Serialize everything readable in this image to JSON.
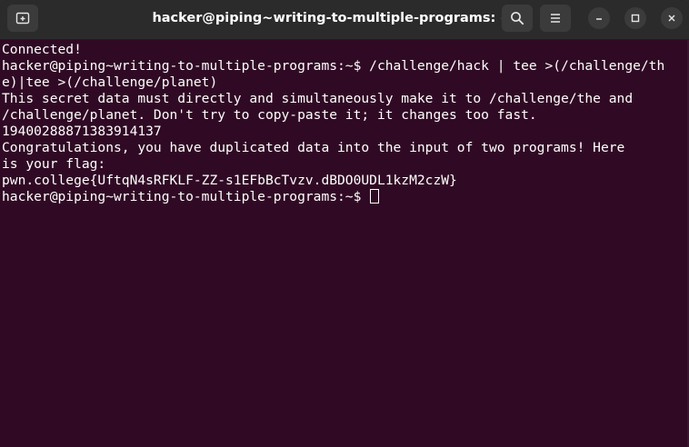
{
  "window": {
    "title": "hacker@piping~writing-to-multiple-programs: ~"
  },
  "titlebar_icons": {
    "new_tab": "new-tab-icon",
    "search": "search-icon",
    "menu": "hamburger-menu-icon",
    "minimize": "minimize-icon",
    "maximize": "maximize-icon",
    "close": "close-icon"
  },
  "terminal": {
    "lines": [
      "Connected!",
      "hacker@piping~writing-to-multiple-programs:~$ /challenge/hack | tee >(/challenge/th",
      "e)|tee >(/challenge/planet)",
      "This secret data must directly and simultaneously make it to /challenge/the and",
      "/challenge/planet. Don't try to copy-paste it; it changes too fast.",
      "19400288871383914137",
      "Congratulations, you have duplicated data into the input of two programs! Here",
      "is your flag:",
      "pwn.college{UftqN4sRFKLF-ZZ-s1EFbBcTvzv.dBDO0UDL1kzM2czW}"
    ],
    "prompt": "hacker@piping~writing-to-multiple-programs:~$ "
  },
  "colors": {
    "terminal_bg": "#300a24",
    "titlebar_bg": "#2b2b2b",
    "text": "#ffffff"
  }
}
